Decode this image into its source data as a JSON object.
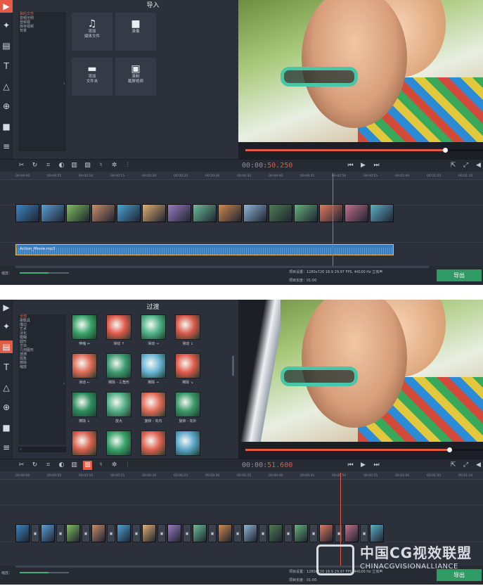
{
  "colors": {
    "accent": "#e45a45",
    "export": "#2f9a63",
    "bg": "#2b303b"
  },
  "panel1": {
    "title": "导入",
    "categories": [
      "我的文件",
      "音频示例",
      "音频视",
      "库存视频",
      "背景"
    ],
    "tiles": [
      {
        "icon": "music-video-icon",
        "line1": "添加",
        "line2": "媒体文件"
      },
      {
        "icon": "camera-icon",
        "line1": "录像",
        "line2": ""
      },
      {
        "icon": "folder-icon",
        "line1": "添加",
        "line2": "文件夹"
      },
      {
        "icon": "screen-record-icon",
        "line1": "录制",
        "line2": "截屏视频"
      }
    ],
    "time_prefix": "00:00:",
    "time_value": "50.250",
    "progress": 0.84,
    "audio_label": "Action_Movie.mp3",
    "info_line1": "项目设置：1280x720 16:9 29.97 FPS, 44100 Hz 立体声",
    "info_line2": "项目长度：01:00",
    "export": "导出",
    "zoom_label": "缩放："
  },
  "panel2": {
    "title": "过渡",
    "categories": [
      "全部",
      "歌截具",
      "描边",
      "艺术",
      "淡化",
      "模糊",
      "圆形",
      "方块",
      "几何图形",
      "涟漪",
      "需象",
      "擦除",
      "缩放"
    ],
    "transitions": [
      "伸缩 ↔",
      "滑动 ↑",
      "滑动 →",
      "滑动 ↓",
      "滑动 ←",
      "擦除 - 三角形",
      "擦除 →",
      "擦除 ↘",
      "擦除 ↓",
      "放大",
      "旋转 - 向内",
      "旋转 - 向外"
    ],
    "time_prefix": "00:00:",
    "time_value": "51.600",
    "progress": 0.86,
    "info_line1": "项目设置：1280x720 16:9 29.97 FPS, 44100 Hz 立体声",
    "info_line2": "项目长度：01:00",
    "export": "导出",
    "zoom_label": "缩放："
  },
  "ruler_ticks": [
    "00:00:00",
    "00:00:05",
    "00:00:10",
    "00:00:15",
    "00:00:20",
    "00:00:25",
    "00:00:30",
    "00:00:35",
    "00:00:40",
    "00:00:45",
    "00:00:50",
    "00:00:55",
    "00:01:00",
    "00:01:05",
    "00:01:10"
  ],
  "watermark": {
    "title": "中国CG视效联盟",
    "subtitle": "CHINACGVISIONALLIANCE"
  }
}
